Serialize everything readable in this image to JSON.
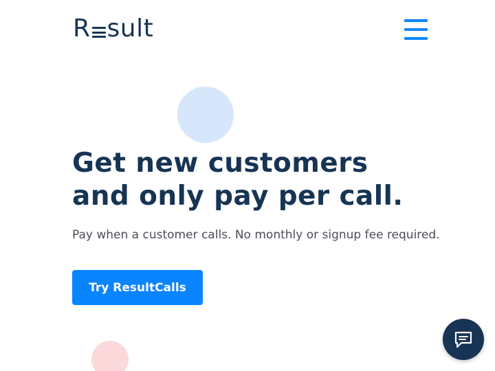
{
  "brand": {
    "logo_text_start": "R",
    "logo_text_end": "sult",
    "logo_alt": "Result",
    "color_dark": "#173454",
    "color_accent": "#0a84ff"
  },
  "header": {
    "menu_icon": "hamburger-menu-icon"
  },
  "hero": {
    "headline": "Get new customers and only pay per call.",
    "subtext": "Pay when a customer calls. No monthly or signup fee required.",
    "cta_label": "Try ResultCalls"
  },
  "chat": {
    "icon": "chat-bubble-icon"
  }
}
